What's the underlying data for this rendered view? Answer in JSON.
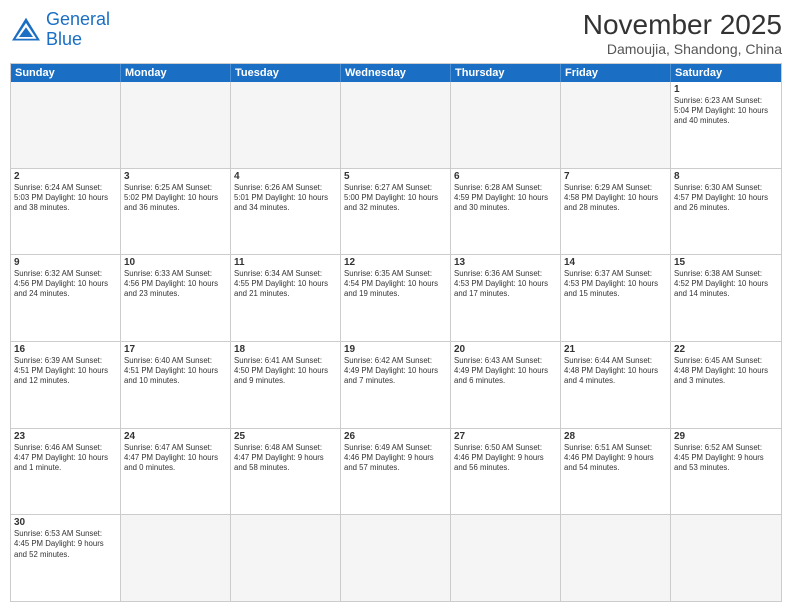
{
  "logo": {
    "line1": "General",
    "line2": "Blue"
  },
  "title": "November 2025",
  "subtitle": "Damoujia, Shandong, China",
  "weekdays": [
    "Sunday",
    "Monday",
    "Tuesday",
    "Wednesday",
    "Thursday",
    "Friday",
    "Saturday"
  ],
  "rows": [
    [
      {
        "day": "",
        "info": "",
        "empty": true
      },
      {
        "day": "",
        "info": "",
        "empty": true
      },
      {
        "day": "",
        "info": "",
        "empty": true
      },
      {
        "day": "",
        "info": "",
        "empty": true
      },
      {
        "day": "",
        "info": "",
        "empty": true
      },
      {
        "day": "",
        "info": "",
        "empty": true
      },
      {
        "day": "1",
        "info": "Sunrise: 6:23 AM\nSunset: 5:04 PM\nDaylight: 10 hours and 40 minutes.",
        "empty": false
      }
    ],
    [
      {
        "day": "2",
        "info": "Sunrise: 6:24 AM\nSunset: 5:03 PM\nDaylight: 10 hours and 38 minutes.",
        "empty": false
      },
      {
        "day": "3",
        "info": "Sunrise: 6:25 AM\nSunset: 5:02 PM\nDaylight: 10 hours and 36 minutes.",
        "empty": false
      },
      {
        "day": "4",
        "info": "Sunrise: 6:26 AM\nSunset: 5:01 PM\nDaylight: 10 hours and 34 minutes.",
        "empty": false
      },
      {
        "day": "5",
        "info": "Sunrise: 6:27 AM\nSunset: 5:00 PM\nDaylight: 10 hours and 32 minutes.",
        "empty": false
      },
      {
        "day": "6",
        "info": "Sunrise: 6:28 AM\nSunset: 4:59 PM\nDaylight: 10 hours and 30 minutes.",
        "empty": false
      },
      {
        "day": "7",
        "info": "Sunrise: 6:29 AM\nSunset: 4:58 PM\nDaylight: 10 hours and 28 minutes.",
        "empty": false
      },
      {
        "day": "8",
        "info": "Sunrise: 6:30 AM\nSunset: 4:57 PM\nDaylight: 10 hours and 26 minutes.",
        "empty": false
      }
    ],
    [
      {
        "day": "9",
        "info": "Sunrise: 6:32 AM\nSunset: 4:56 PM\nDaylight: 10 hours and 24 minutes.",
        "empty": false
      },
      {
        "day": "10",
        "info": "Sunrise: 6:33 AM\nSunset: 4:56 PM\nDaylight: 10 hours and 23 minutes.",
        "empty": false
      },
      {
        "day": "11",
        "info": "Sunrise: 6:34 AM\nSunset: 4:55 PM\nDaylight: 10 hours and 21 minutes.",
        "empty": false
      },
      {
        "day": "12",
        "info": "Sunrise: 6:35 AM\nSunset: 4:54 PM\nDaylight: 10 hours and 19 minutes.",
        "empty": false
      },
      {
        "day": "13",
        "info": "Sunrise: 6:36 AM\nSunset: 4:53 PM\nDaylight: 10 hours and 17 minutes.",
        "empty": false
      },
      {
        "day": "14",
        "info": "Sunrise: 6:37 AM\nSunset: 4:53 PM\nDaylight: 10 hours and 15 minutes.",
        "empty": false
      },
      {
        "day": "15",
        "info": "Sunrise: 6:38 AM\nSunset: 4:52 PM\nDaylight: 10 hours and 14 minutes.",
        "empty": false
      }
    ],
    [
      {
        "day": "16",
        "info": "Sunrise: 6:39 AM\nSunset: 4:51 PM\nDaylight: 10 hours and 12 minutes.",
        "empty": false
      },
      {
        "day": "17",
        "info": "Sunrise: 6:40 AM\nSunset: 4:51 PM\nDaylight: 10 hours and 10 minutes.",
        "empty": false
      },
      {
        "day": "18",
        "info": "Sunrise: 6:41 AM\nSunset: 4:50 PM\nDaylight: 10 hours and 9 minutes.",
        "empty": false
      },
      {
        "day": "19",
        "info": "Sunrise: 6:42 AM\nSunset: 4:49 PM\nDaylight: 10 hours and 7 minutes.",
        "empty": false
      },
      {
        "day": "20",
        "info": "Sunrise: 6:43 AM\nSunset: 4:49 PM\nDaylight: 10 hours and 6 minutes.",
        "empty": false
      },
      {
        "day": "21",
        "info": "Sunrise: 6:44 AM\nSunset: 4:48 PM\nDaylight: 10 hours and 4 minutes.",
        "empty": false
      },
      {
        "day": "22",
        "info": "Sunrise: 6:45 AM\nSunset: 4:48 PM\nDaylight: 10 hours and 3 minutes.",
        "empty": false
      }
    ],
    [
      {
        "day": "23",
        "info": "Sunrise: 6:46 AM\nSunset: 4:47 PM\nDaylight: 10 hours and 1 minute.",
        "empty": false
      },
      {
        "day": "24",
        "info": "Sunrise: 6:47 AM\nSunset: 4:47 PM\nDaylight: 10 hours and 0 minutes.",
        "empty": false
      },
      {
        "day": "25",
        "info": "Sunrise: 6:48 AM\nSunset: 4:47 PM\nDaylight: 9 hours and 58 minutes.",
        "empty": false
      },
      {
        "day": "26",
        "info": "Sunrise: 6:49 AM\nSunset: 4:46 PM\nDaylight: 9 hours and 57 minutes.",
        "empty": false
      },
      {
        "day": "27",
        "info": "Sunrise: 6:50 AM\nSunset: 4:46 PM\nDaylight: 9 hours and 56 minutes.",
        "empty": false
      },
      {
        "day": "28",
        "info": "Sunrise: 6:51 AM\nSunset: 4:46 PM\nDaylight: 9 hours and 54 minutes.",
        "empty": false
      },
      {
        "day": "29",
        "info": "Sunrise: 6:52 AM\nSunset: 4:45 PM\nDaylight: 9 hours and 53 minutes.",
        "empty": false
      }
    ],
    [
      {
        "day": "30",
        "info": "Sunrise: 6:53 AM\nSunset: 4:45 PM\nDaylight: 9 hours and 52 minutes.",
        "empty": false
      },
      {
        "day": "",
        "info": "",
        "empty": true
      },
      {
        "day": "",
        "info": "",
        "empty": true
      },
      {
        "day": "",
        "info": "",
        "empty": true
      },
      {
        "day": "",
        "info": "",
        "empty": true
      },
      {
        "day": "",
        "info": "",
        "empty": true
      },
      {
        "day": "",
        "info": "",
        "empty": true
      }
    ]
  ]
}
